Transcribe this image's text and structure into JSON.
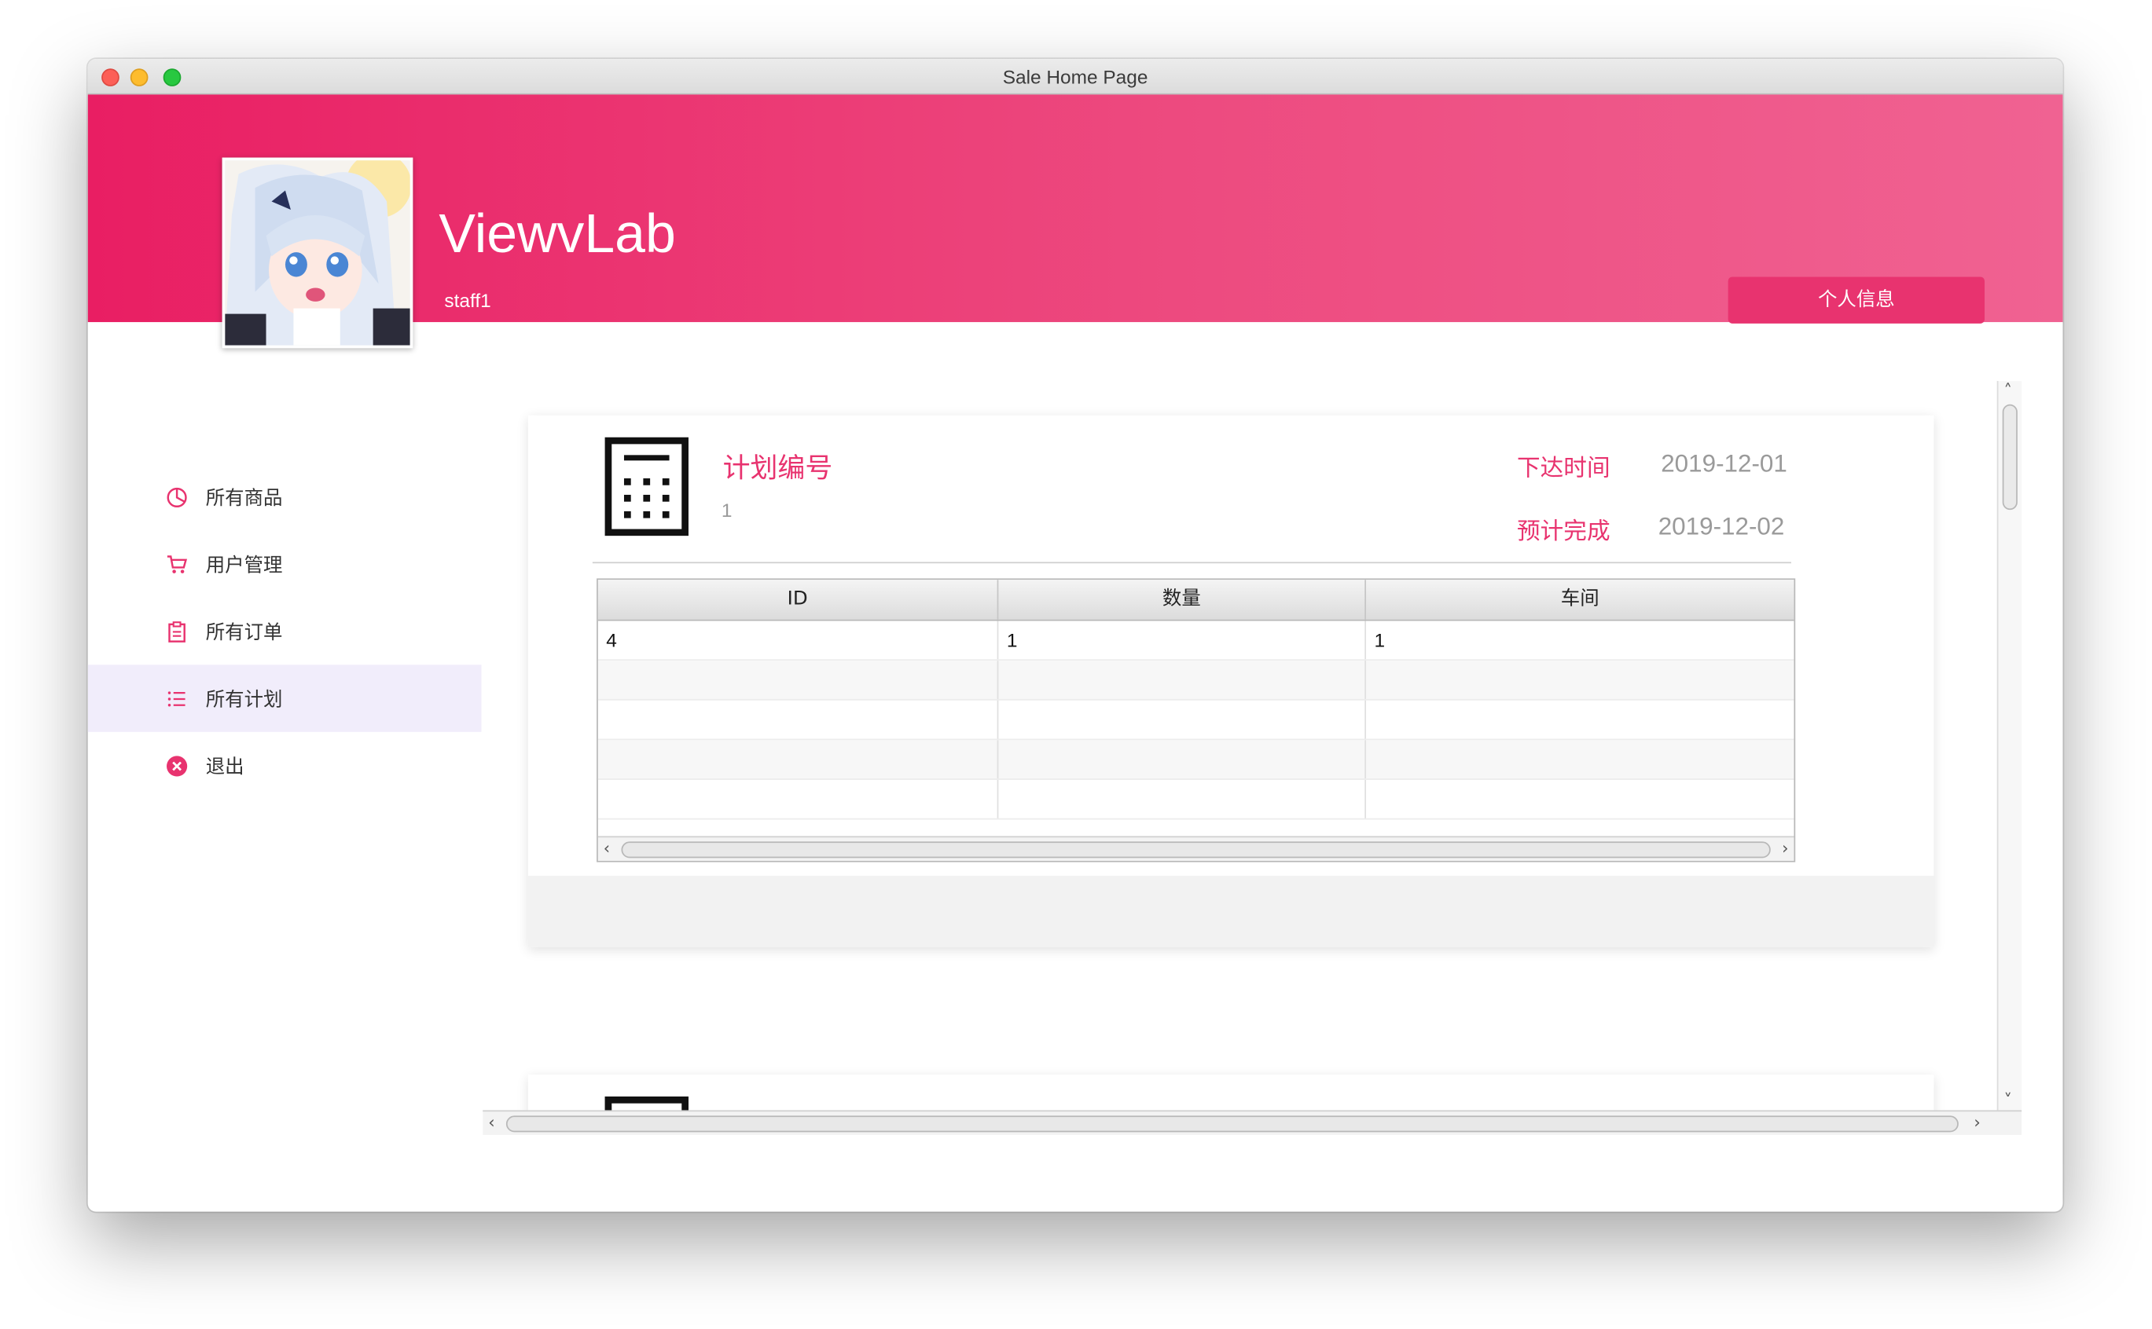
{
  "window": {
    "title": "Sale Home Page"
  },
  "header": {
    "app_name": "ViewvLab",
    "username": "staff1",
    "profile_button": "个人信息",
    "gradient": [
      "#e91e63",
      "#f06292"
    ]
  },
  "sidebar": {
    "items": [
      {
        "label": "所有商品",
        "icon": "pie-chart-icon",
        "active": false
      },
      {
        "label": "用户管理",
        "icon": "cart-icon",
        "active": false
      },
      {
        "label": "所有订单",
        "icon": "clipboard-icon",
        "active": false
      },
      {
        "label": "所有计划",
        "icon": "list-icon",
        "active": true
      },
      {
        "label": "退出",
        "icon": "close-circle-icon",
        "active": false
      }
    ]
  },
  "plan_card": {
    "icon": "calculator-icon",
    "plan_label": "计划编号",
    "plan_value": "1",
    "issue_label": "下达时间",
    "issue_date": "2019-12-01",
    "complete_label": "预计完成",
    "complete_date": "2019-12-02",
    "table": {
      "columns": [
        "ID",
        "数量",
        "车间"
      ],
      "rows": [
        [
          "4",
          "1",
          "1"
        ]
      ]
    }
  },
  "colors": {
    "accent": "#e8336f",
    "active_bg": "#f1edfb"
  }
}
